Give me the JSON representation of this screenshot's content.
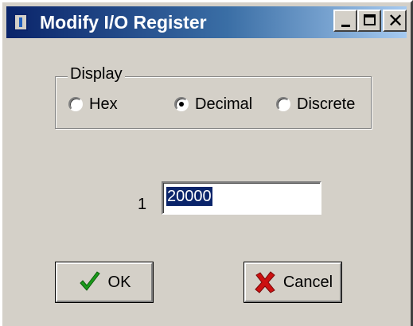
{
  "window": {
    "title": "Modify I/O Register",
    "controls": {
      "minimize": "minimize",
      "maximize": "maximize",
      "close": "✕"
    }
  },
  "display_group": {
    "label": "Display",
    "options": [
      {
        "label": "Hex",
        "selected": false
      },
      {
        "label": "Decimal",
        "selected": true
      },
      {
        "label": "Discrete",
        "selected": false
      }
    ]
  },
  "register": {
    "index_label": "1",
    "value": "20000"
  },
  "buttons": {
    "ok_label": "OK",
    "cancel_label": "Cancel"
  },
  "icons": {
    "ok": "checkmark-icon",
    "cancel": "x-icon"
  },
  "colors": {
    "titlebar_start": "#0a246a",
    "titlebar_end": "#a6caf0",
    "selection": "#0a246a",
    "checkmark": "#1a9a1a",
    "cancel_x": "#cc1111"
  }
}
